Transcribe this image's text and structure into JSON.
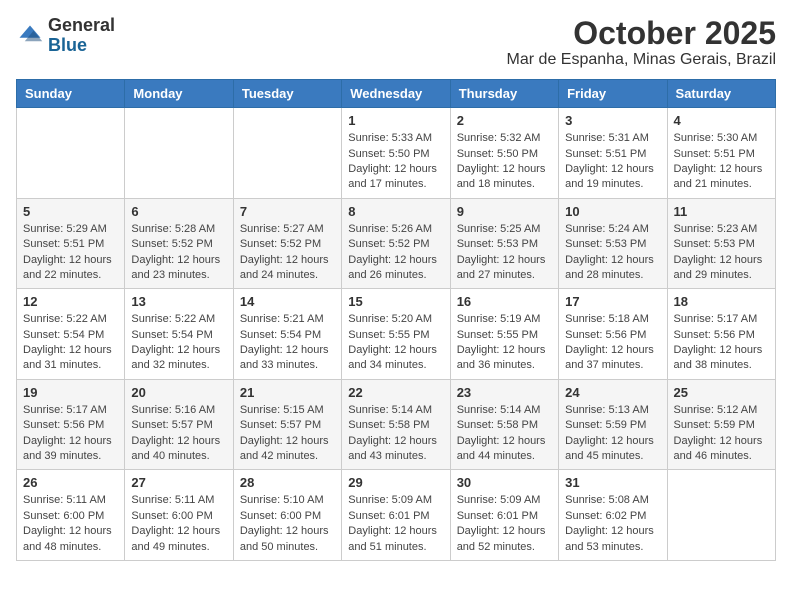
{
  "logo": {
    "line1": "General",
    "line2": "Blue"
  },
  "header": {
    "month": "October 2025",
    "location": "Mar de Espanha, Minas Gerais, Brazil"
  },
  "weekdays": [
    "Sunday",
    "Monday",
    "Tuesday",
    "Wednesday",
    "Thursday",
    "Friday",
    "Saturday"
  ],
  "weeks": [
    [
      {
        "day": "",
        "sunrise": "",
        "sunset": "",
        "daylight": ""
      },
      {
        "day": "",
        "sunrise": "",
        "sunset": "",
        "daylight": ""
      },
      {
        "day": "",
        "sunrise": "",
        "sunset": "",
        "daylight": ""
      },
      {
        "day": "1",
        "sunrise": "Sunrise: 5:33 AM",
        "sunset": "Sunset: 5:50 PM",
        "daylight": "Daylight: 12 hours and 17 minutes."
      },
      {
        "day": "2",
        "sunrise": "Sunrise: 5:32 AM",
        "sunset": "Sunset: 5:50 PM",
        "daylight": "Daylight: 12 hours and 18 minutes."
      },
      {
        "day": "3",
        "sunrise": "Sunrise: 5:31 AM",
        "sunset": "Sunset: 5:51 PM",
        "daylight": "Daylight: 12 hours and 19 minutes."
      },
      {
        "day": "4",
        "sunrise": "Sunrise: 5:30 AM",
        "sunset": "Sunset: 5:51 PM",
        "daylight": "Daylight: 12 hours and 21 minutes."
      }
    ],
    [
      {
        "day": "5",
        "sunrise": "Sunrise: 5:29 AM",
        "sunset": "Sunset: 5:51 PM",
        "daylight": "Daylight: 12 hours and 22 minutes."
      },
      {
        "day": "6",
        "sunrise": "Sunrise: 5:28 AM",
        "sunset": "Sunset: 5:52 PM",
        "daylight": "Daylight: 12 hours and 23 minutes."
      },
      {
        "day": "7",
        "sunrise": "Sunrise: 5:27 AM",
        "sunset": "Sunset: 5:52 PM",
        "daylight": "Daylight: 12 hours and 24 minutes."
      },
      {
        "day": "8",
        "sunrise": "Sunrise: 5:26 AM",
        "sunset": "Sunset: 5:52 PM",
        "daylight": "Daylight: 12 hours and 26 minutes."
      },
      {
        "day": "9",
        "sunrise": "Sunrise: 5:25 AM",
        "sunset": "Sunset: 5:53 PM",
        "daylight": "Daylight: 12 hours and 27 minutes."
      },
      {
        "day": "10",
        "sunrise": "Sunrise: 5:24 AM",
        "sunset": "Sunset: 5:53 PM",
        "daylight": "Daylight: 12 hours and 28 minutes."
      },
      {
        "day": "11",
        "sunrise": "Sunrise: 5:23 AM",
        "sunset": "Sunset: 5:53 PM",
        "daylight": "Daylight: 12 hours and 29 minutes."
      }
    ],
    [
      {
        "day": "12",
        "sunrise": "Sunrise: 5:22 AM",
        "sunset": "Sunset: 5:54 PM",
        "daylight": "Daylight: 12 hours and 31 minutes."
      },
      {
        "day": "13",
        "sunrise": "Sunrise: 5:22 AM",
        "sunset": "Sunset: 5:54 PM",
        "daylight": "Daylight: 12 hours and 32 minutes."
      },
      {
        "day": "14",
        "sunrise": "Sunrise: 5:21 AM",
        "sunset": "Sunset: 5:54 PM",
        "daylight": "Daylight: 12 hours and 33 minutes."
      },
      {
        "day": "15",
        "sunrise": "Sunrise: 5:20 AM",
        "sunset": "Sunset: 5:55 PM",
        "daylight": "Daylight: 12 hours and 34 minutes."
      },
      {
        "day": "16",
        "sunrise": "Sunrise: 5:19 AM",
        "sunset": "Sunset: 5:55 PM",
        "daylight": "Daylight: 12 hours and 36 minutes."
      },
      {
        "day": "17",
        "sunrise": "Sunrise: 5:18 AM",
        "sunset": "Sunset: 5:56 PM",
        "daylight": "Daylight: 12 hours and 37 minutes."
      },
      {
        "day": "18",
        "sunrise": "Sunrise: 5:17 AM",
        "sunset": "Sunset: 5:56 PM",
        "daylight": "Daylight: 12 hours and 38 minutes."
      }
    ],
    [
      {
        "day": "19",
        "sunrise": "Sunrise: 5:17 AM",
        "sunset": "Sunset: 5:56 PM",
        "daylight": "Daylight: 12 hours and 39 minutes."
      },
      {
        "day": "20",
        "sunrise": "Sunrise: 5:16 AM",
        "sunset": "Sunset: 5:57 PM",
        "daylight": "Daylight: 12 hours and 40 minutes."
      },
      {
        "day": "21",
        "sunrise": "Sunrise: 5:15 AM",
        "sunset": "Sunset: 5:57 PM",
        "daylight": "Daylight: 12 hours and 42 minutes."
      },
      {
        "day": "22",
        "sunrise": "Sunrise: 5:14 AM",
        "sunset": "Sunset: 5:58 PM",
        "daylight": "Daylight: 12 hours and 43 minutes."
      },
      {
        "day": "23",
        "sunrise": "Sunrise: 5:14 AM",
        "sunset": "Sunset: 5:58 PM",
        "daylight": "Daylight: 12 hours and 44 minutes."
      },
      {
        "day": "24",
        "sunrise": "Sunrise: 5:13 AM",
        "sunset": "Sunset: 5:59 PM",
        "daylight": "Daylight: 12 hours and 45 minutes."
      },
      {
        "day": "25",
        "sunrise": "Sunrise: 5:12 AM",
        "sunset": "Sunset: 5:59 PM",
        "daylight": "Daylight: 12 hours and 46 minutes."
      }
    ],
    [
      {
        "day": "26",
        "sunrise": "Sunrise: 5:11 AM",
        "sunset": "Sunset: 6:00 PM",
        "daylight": "Daylight: 12 hours and 48 minutes."
      },
      {
        "day": "27",
        "sunrise": "Sunrise: 5:11 AM",
        "sunset": "Sunset: 6:00 PM",
        "daylight": "Daylight: 12 hours and 49 minutes."
      },
      {
        "day": "28",
        "sunrise": "Sunrise: 5:10 AM",
        "sunset": "Sunset: 6:00 PM",
        "daylight": "Daylight: 12 hours and 50 minutes."
      },
      {
        "day": "29",
        "sunrise": "Sunrise: 5:09 AM",
        "sunset": "Sunset: 6:01 PM",
        "daylight": "Daylight: 12 hours and 51 minutes."
      },
      {
        "day": "30",
        "sunrise": "Sunrise: 5:09 AM",
        "sunset": "Sunset: 6:01 PM",
        "daylight": "Daylight: 12 hours and 52 minutes."
      },
      {
        "day": "31",
        "sunrise": "Sunrise: 5:08 AM",
        "sunset": "Sunset: 6:02 PM",
        "daylight": "Daylight: 12 hours and 53 minutes."
      },
      {
        "day": "",
        "sunrise": "",
        "sunset": "",
        "daylight": ""
      }
    ]
  ]
}
